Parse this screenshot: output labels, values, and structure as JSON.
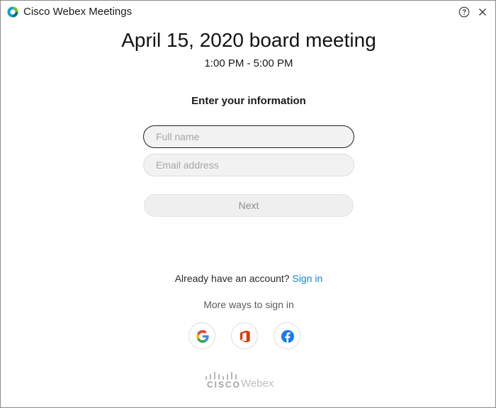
{
  "window": {
    "title": "Cisco Webex Meetings"
  },
  "meeting": {
    "title": "April 15, 2020 board meeting",
    "time": "1:00 PM - 5:00 PM"
  },
  "form": {
    "heading": "Enter your information",
    "full_name_placeholder": "Full name",
    "full_name_value": "",
    "email_placeholder": "Email address",
    "email_value": "",
    "next_label": "Next"
  },
  "account": {
    "prompt": "Already have an account?",
    "signin_label": "Sign in"
  },
  "more_ways": {
    "label": "More ways to sign in",
    "providers": [
      "google-icon",
      "office-icon",
      "facebook-icon"
    ]
  },
  "footer": {
    "cisco_label": "CISCO",
    "product_label": "Webex"
  },
  "colors": {
    "link": "#0a8ad1",
    "office": "#d83b01",
    "facebook": "#1877f2"
  },
  "icons": {
    "app": "webex-logo-icon",
    "help": "help-icon",
    "close": "close-icon"
  }
}
